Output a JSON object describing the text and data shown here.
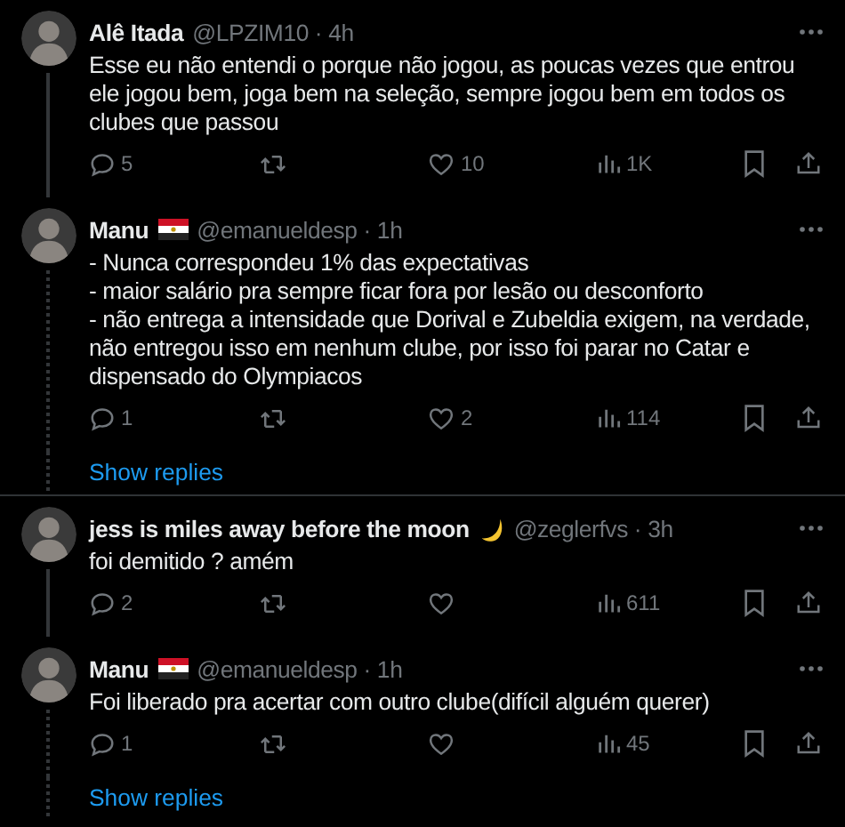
{
  "threads": [
    {
      "tweets": [
        {
          "name": "Alê Itada",
          "kind": "plain",
          "meta": "@LPZIM10 · 4h",
          "text": "Esse eu não entendi o porque não jogou, as poucas vezes que entrou ele jogou bem, joga bem na seleção, sempre jogou bem em todos os clubes que passou",
          "replies": "5",
          "likes": "10",
          "views": "1K"
        },
        {
          "name": "Manu",
          "kind": "flag",
          "meta": "@emanueldesp · 1h",
          "text": "- Nunca correspondeu 1% das expectativas\n- maior salário pra sempre ficar fora por lesão ou desconforto\n- não entrega a intensidade que Dorival e Zubeldia exigem, na verdade, não entregou isso em nenhum clube, por isso foi parar no Catar e dispensado do Olympiacos",
          "replies": "1",
          "likes": "2",
          "views": "114"
        }
      ],
      "show_replies": "Show replies"
    },
    {
      "tweets": [
        {
          "name": "jess is miles away before the moon",
          "kind": "moon",
          "meta": "@zeglerfvs · 3h",
          "text": "foi demitido ? amém",
          "replies": "2",
          "views": "611"
        },
        {
          "name": "Manu",
          "kind": "flag",
          "meta": "@emanueldesp · 1h",
          "text": "Foi liberado pra acertar com outro clube(difícil alguém querer)",
          "replies": "1",
          "views": "45"
        }
      ],
      "show_replies": "Show replies"
    }
  ]
}
